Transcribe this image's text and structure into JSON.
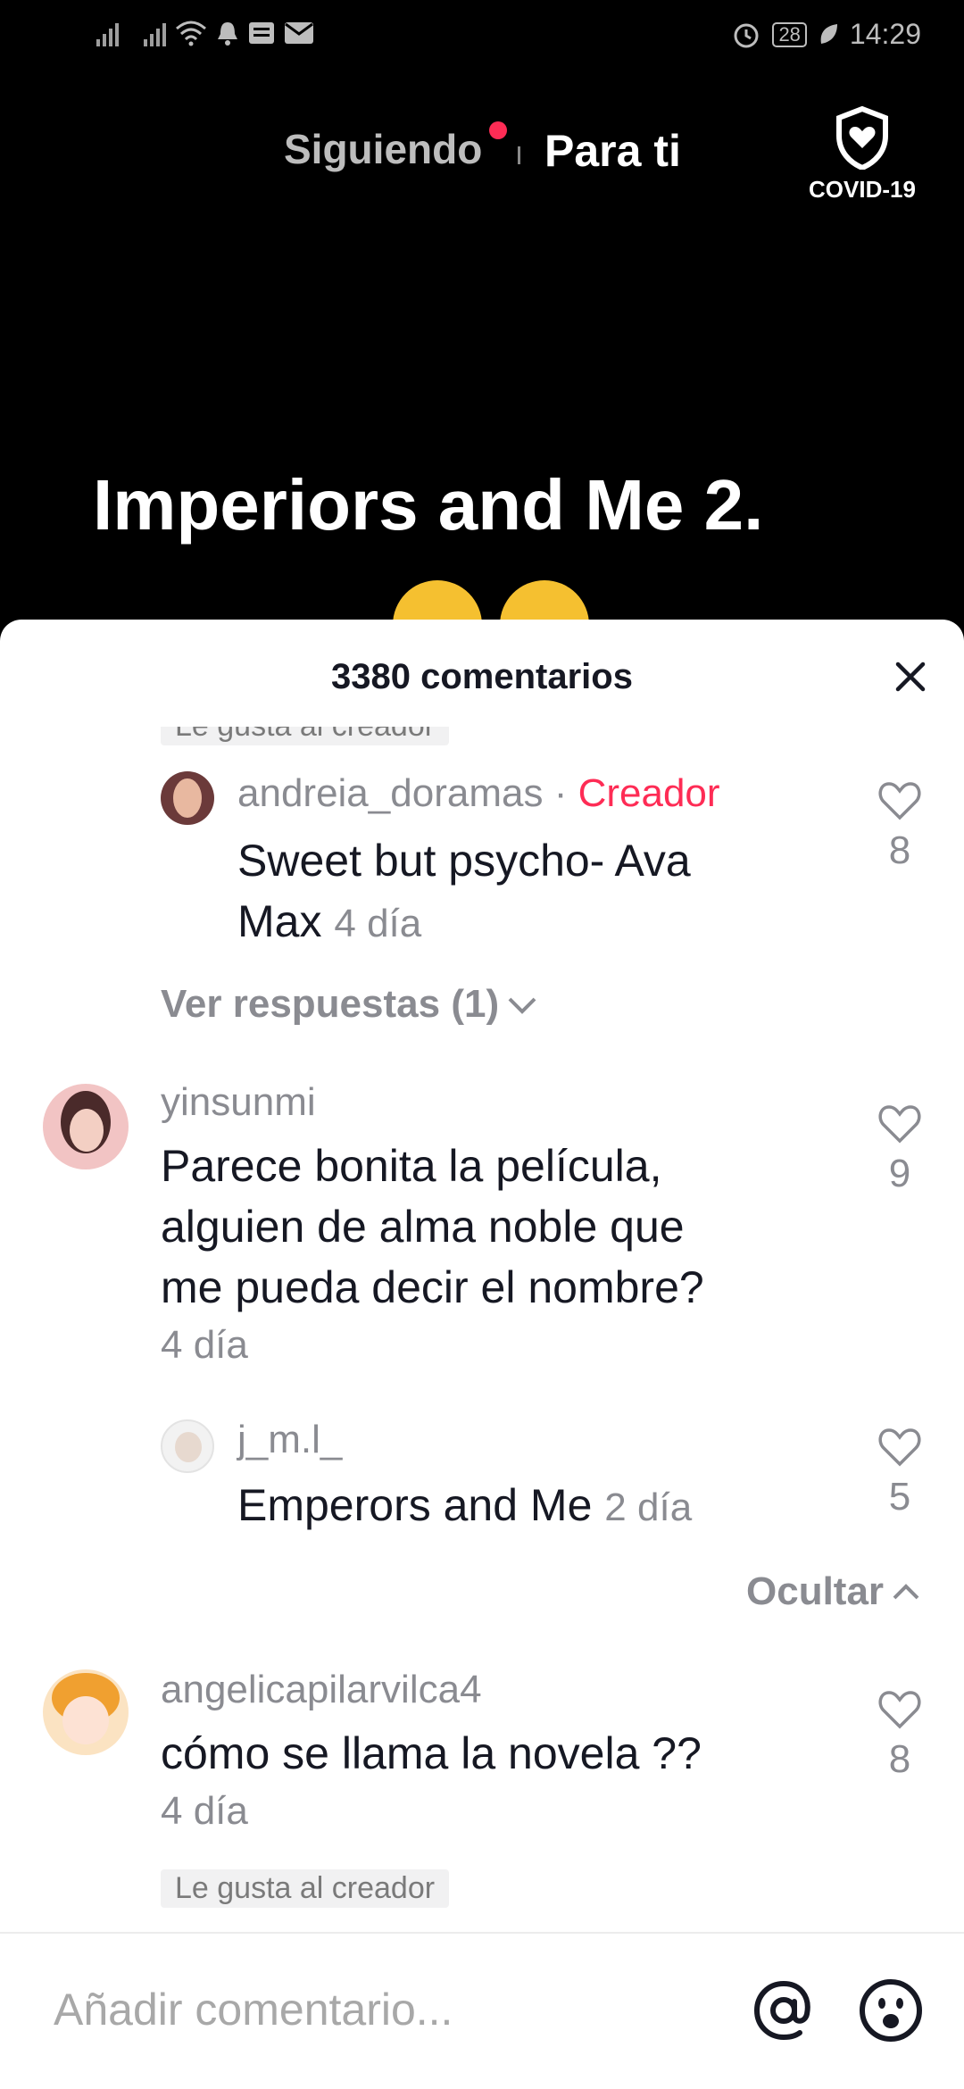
{
  "status_bar": {
    "time": "14:29",
    "battery": "28"
  },
  "top_nav": {
    "following": "Siguiendo",
    "for_you": "Para ti",
    "covid_label": "COVID-19"
  },
  "video": {
    "caption": "Imperiors and Me 2."
  },
  "comments": {
    "title": "3380 comentarios",
    "liked_by_creator": "Le gusta al creador",
    "items": [
      {
        "user": "andreia_doramas",
        "separator": "·",
        "badge": "Creador",
        "text_line1": "Sweet but psycho- Ava",
        "text_line2": "Max",
        "time": "4 día",
        "likes": "8"
      },
      {
        "view_replies": "Ver respuestas (1)"
      },
      {
        "user": "yinsunmi",
        "text_line1": "Parece bonita la película,",
        "text_line2": "alguien de alma noble que",
        "text_line3": "me pueda decir el nombre?",
        "time": "4 día",
        "likes": "9"
      },
      {
        "user": "j_m.l_",
        "text": "Emperors and Me",
        "time": "2 día",
        "likes": "5"
      },
      {
        "hide": "Ocultar"
      },
      {
        "user": "angelicapilarvilca4",
        "text": "cómo se llama la novela ??",
        "time": "4 día",
        "likes": "8"
      }
    ]
  },
  "input": {
    "placeholder": "Añadir comentario..."
  },
  "colors": {
    "accent": "#fe2c55",
    "muted": "#8a8b91",
    "text": "#161823"
  }
}
